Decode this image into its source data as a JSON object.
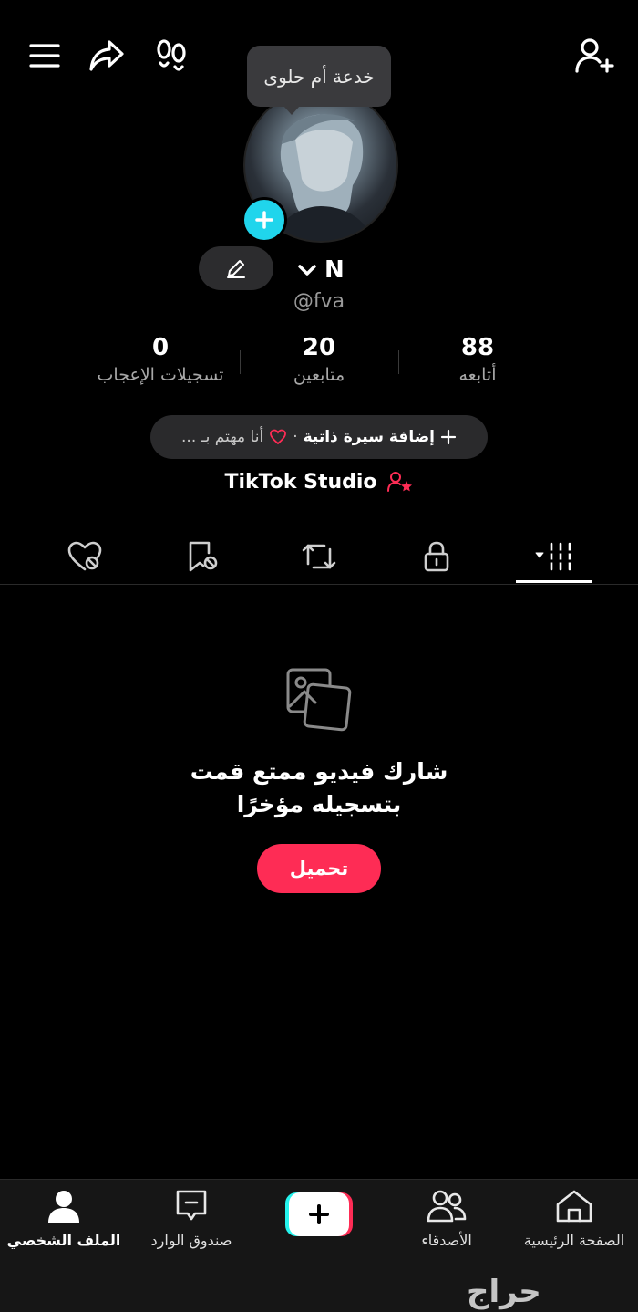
{
  "tooltip": {
    "text": "خدعة أم حلوى"
  },
  "profile": {
    "name": "N",
    "handle": "@fva"
  },
  "stats": [
    {
      "value": "0",
      "label": "تسجيلات الإعجاب"
    },
    {
      "value": "20",
      "label": "متابعين"
    },
    {
      "value": "88",
      "label": "أتابعه"
    }
  ],
  "bio": {
    "add_label": "إضافة سيرة ذاتية",
    "separator": "·",
    "interest_label": "أنا مهتم بـ ..."
  },
  "studio": {
    "label": "TikTok Studio"
  },
  "tabs": [
    "liked-videos-icon",
    "favorites-icon",
    "reposts-icon",
    "private-icon",
    "videos-grid-icon"
  ],
  "empty_state": {
    "line1": "شارك فيديو ممتع قمت",
    "line2": "بتسجيله مؤخرًا",
    "button": "تحميل"
  },
  "bottom_nav": {
    "profile": "الملف الشخصي",
    "inbox": "صندوق الوارد",
    "friends": "الأصدقاء",
    "home": "الصفحة الرئيسية"
  },
  "watermark": {
    "text": "حراج"
  },
  "colors": {
    "accent": "#fe2c55",
    "cyan": "#20d5ec",
    "background": "#000000"
  }
}
